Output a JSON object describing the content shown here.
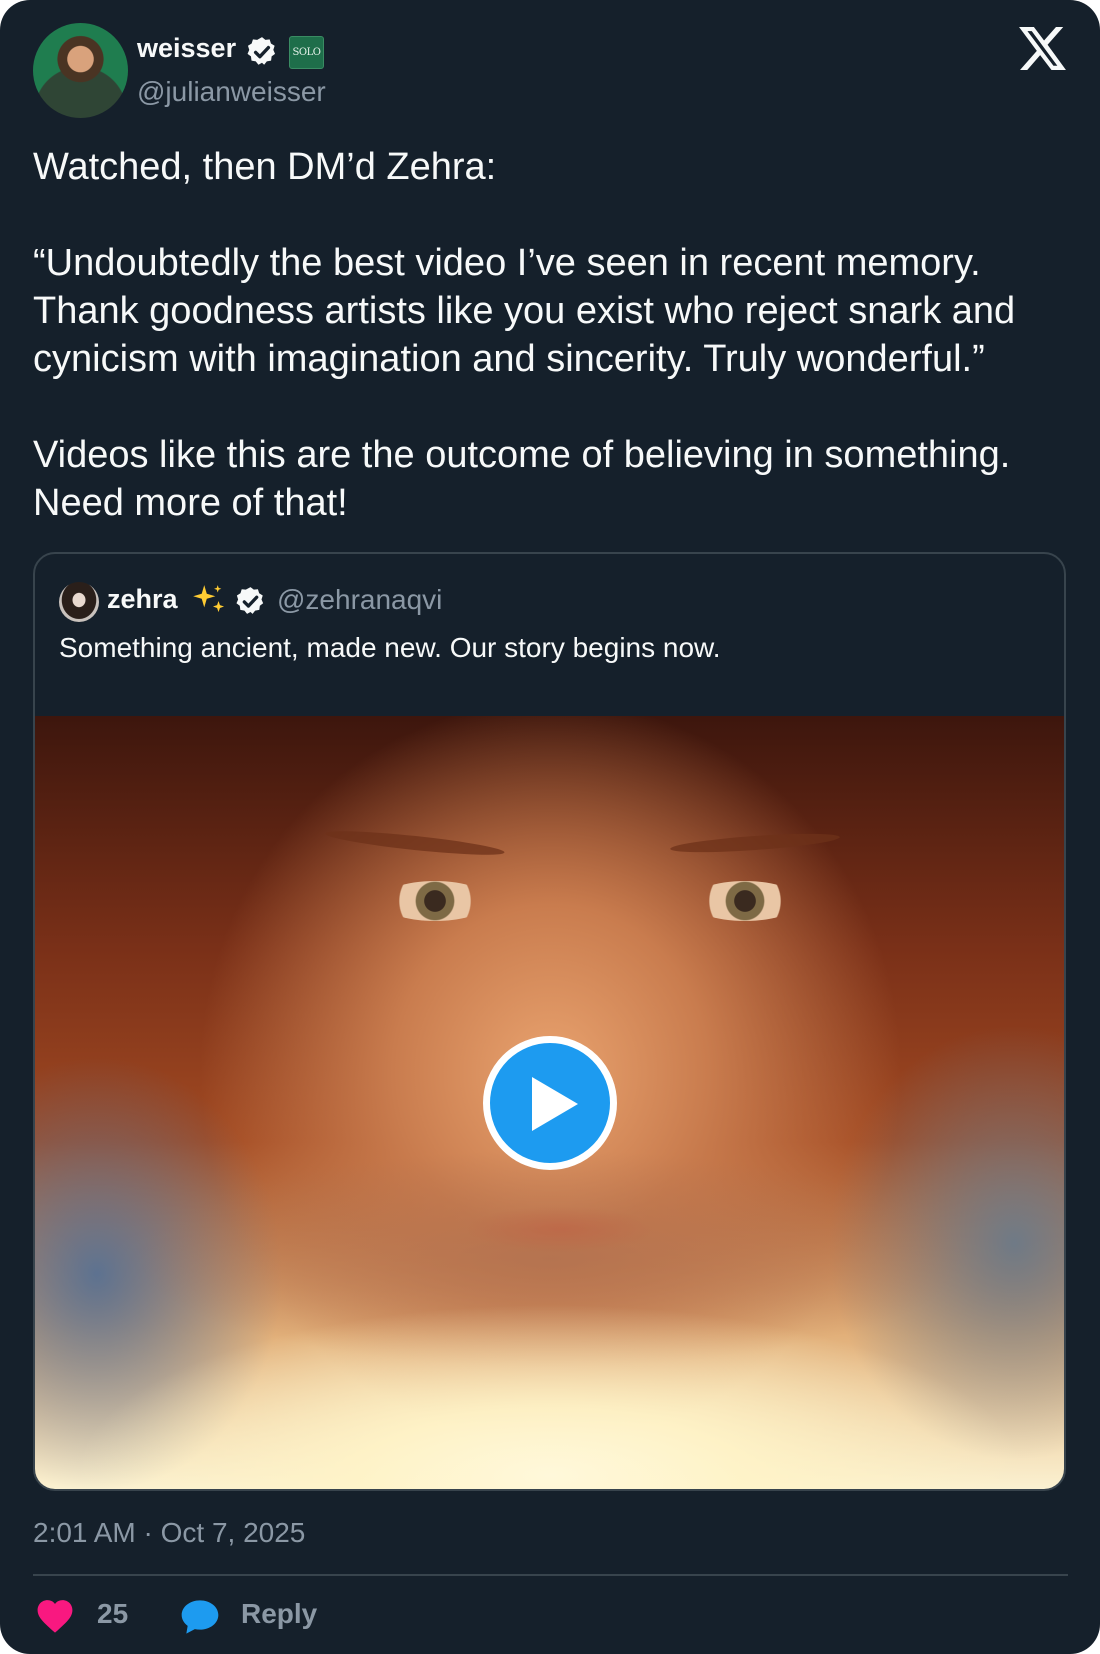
{
  "author": {
    "name": "weisser",
    "handle": "@julianweisser",
    "affiliate_badge": "SOLO",
    "verified": true
  },
  "brand_icon": "x-logo-icon",
  "tweet": {
    "lines": [
      "Watched, then DM’d Zehra:",
      "“Undoubtedly the best video I’ve seen in recent memory. Thank goodness artists like you exist who reject snark and cynicism with imagination and sincerity. Truly wonderful.”",
      "Videos like this are the outcome of believing in something. Need more of that!"
    ]
  },
  "quote": {
    "name": "zehra",
    "emoji": "sparkles-icon",
    "verified": true,
    "handle": "@zehranaqvi",
    "text": "Something ancient, made new. Our story begins now.",
    "media": {
      "type": "video",
      "play_icon": "play-icon"
    }
  },
  "meta": {
    "timestamp": "2:01 AM · Oct 7, 2025"
  },
  "actions": {
    "like_count": "25",
    "reply_label": "Reply"
  },
  "colors": {
    "background": "#15202b",
    "text": "#f7f9f9",
    "muted": "#8b98a5",
    "accent": "#1d9bf0",
    "like": "#f91880",
    "border": "#38444d"
  }
}
